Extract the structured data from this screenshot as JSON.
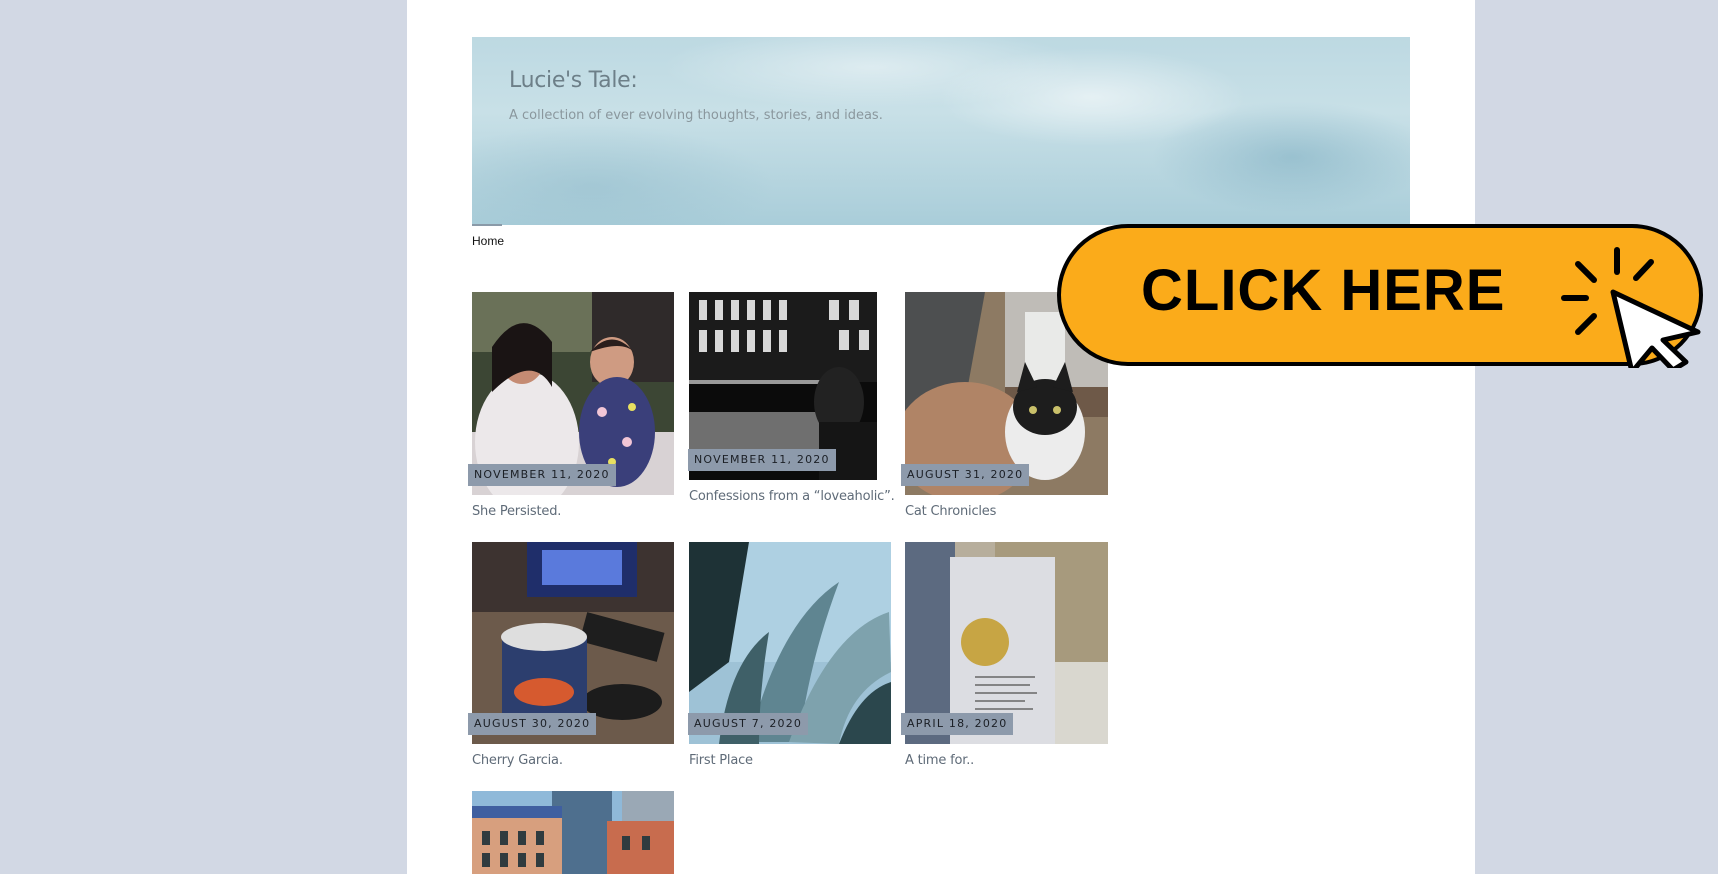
{
  "site": {
    "title": "Lucie's Tale:",
    "description": "A collection of ever evolving thoughts, stories, and ideas."
  },
  "nav": {
    "home": "Home"
  },
  "posts": [
    {
      "date": "NOVEMBER 11, 2020",
      "title": "She Persisted."
    },
    {
      "date": "NOVEMBER 11, 2020",
      "title": "Confessions from a “loveaholic”."
    },
    {
      "date": "AUGUST 31, 2020",
      "title": "Cat Chronicles"
    },
    {
      "date": "AUGUST 30, 2020",
      "title": "Cherry Garcia."
    },
    {
      "date": "AUGUST 7, 2020",
      "title": "First Place"
    },
    {
      "date": "APRIL 18, 2020",
      "title": "A time for.."
    }
  ],
  "banner": {
    "label": "CLICK HERE",
    "icon": "cursor-click-icon",
    "color": "#fbab1a"
  },
  "colors": {
    "background": "#d2d8e4",
    "date_badge": "#8d9aab",
    "header_sky": "#bdd9e2"
  }
}
